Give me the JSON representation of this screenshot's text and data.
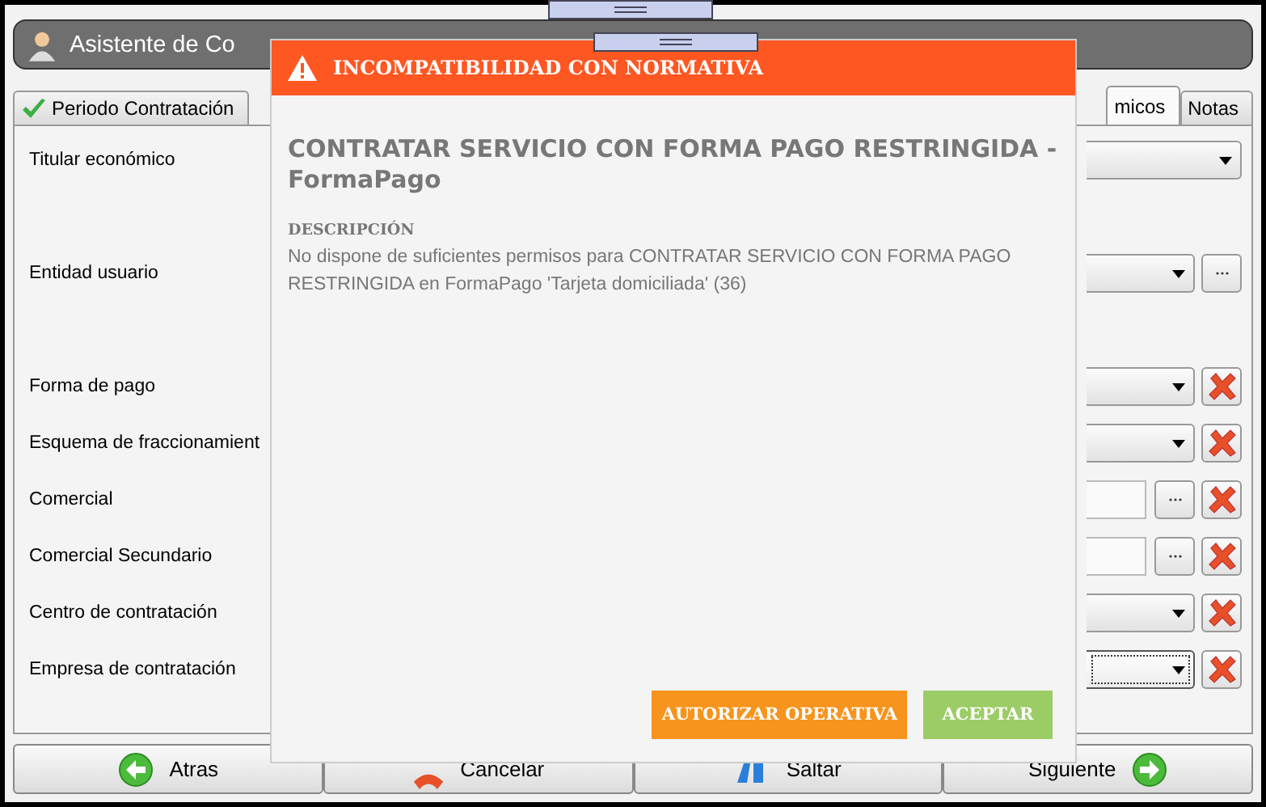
{
  "window": {
    "title": "Asistente de Co"
  },
  "tabs": [
    {
      "label": "Periodo Contratación",
      "selected": false,
      "done": true
    },
    {
      "label": "micos",
      "selected": true,
      "done": false
    },
    {
      "label": "Notas",
      "selected": false,
      "done": false
    }
  ],
  "form": {
    "rows": [
      {
        "label": "Titular económico",
        "kind": "dropdown",
        "lookup": false,
        "clearable": false,
        "focused": false
      },
      {
        "label": "Entidad usuario",
        "kind": "dropdown",
        "lookup": true,
        "clearable": false,
        "focused": false
      },
      {
        "label": "Forma de pago",
        "kind": "dropdown",
        "lookup": false,
        "clearable": true,
        "focused": false
      },
      {
        "label": "Esquema de fraccionamient",
        "kind": "dropdown",
        "lookup": false,
        "clearable": true,
        "focused": false
      },
      {
        "label": "Comercial",
        "kind": "text",
        "lookup": true,
        "clearable": true,
        "focused": false
      },
      {
        "label": "Comercial Secundario",
        "kind": "text",
        "lookup": true,
        "clearable": true,
        "focused": false
      },
      {
        "label": "Centro de contratación",
        "kind": "dropdown",
        "lookup": false,
        "clearable": true,
        "focused": false
      },
      {
        "label": "Empresa de contratación",
        "kind": "dropdown",
        "lookup": false,
        "clearable": true,
        "focused": true
      }
    ]
  },
  "footer": [
    {
      "label": "Atras",
      "kind": "back"
    },
    {
      "label": "Cancelar",
      "kind": "cancel"
    },
    {
      "label": "Saltar",
      "kind": "skip"
    },
    {
      "label": "Siguiente",
      "kind": "next"
    }
  ],
  "dialog": {
    "header": "INCOMPATIBILIDAD CON NORMATIVA",
    "title": "CONTRATAR SERVICIO CON FORMA PAGO RESTRINGIDA - FormaPago",
    "description_label": "DESCRIPCIÓN",
    "description": "No dispone de suficientes permisos para CONTRATAR SERVICIO CON FORMA PAGO RESTRINGIDA en FormaPago 'Tarjeta domiciliada' (36)",
    "buttons": [
      {
        "label": "AUTORIZAR OPERATIVA",
        "kind": "warning"
      },
      {
        "label": "ACEPTAR",
        "kind": "confirm"
      }
    ]
  }
}
